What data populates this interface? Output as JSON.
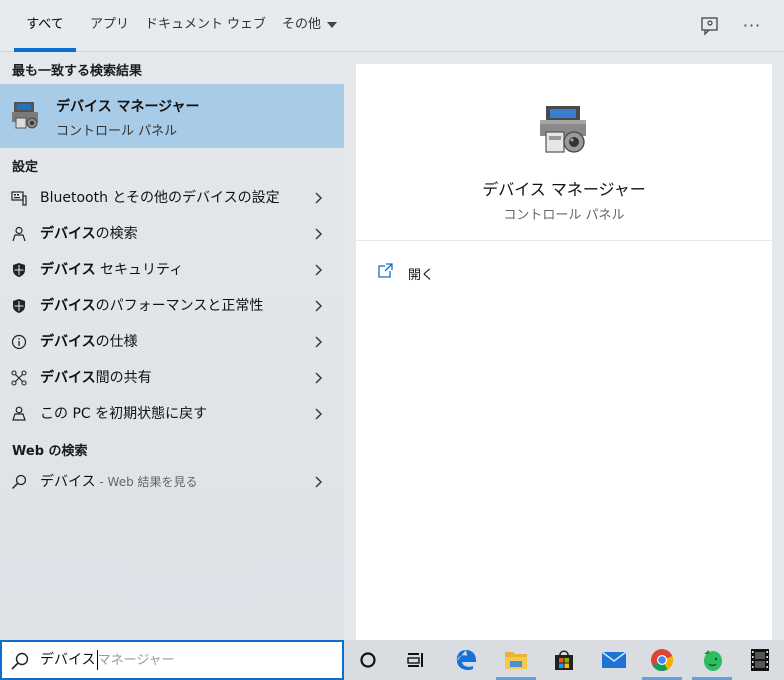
{
  "tabs": [
    {
      "label": "すべて",
      "active": true
    },
    {
      "label": "アプリ"
    },
    {
      "label": "ドキュメント"
    },
    {
      "label": "ウェブ"
    },
    {
      "label": "その他"
    }
  ],
  "top_icons": [
    "feedback-icon",
    "more-options-icon"
  ],
  "left": {
    "best_match_header": "最も一致する検索結果",
    "best_match": {
      "title": "デバイス マネージャー",
      "subtitle": "コントロール パネル",
      "icon": "device-manager-icon"
    },
    "settings_header": "設定",
    "settings_items": [
      {
        "pre": "",
        "bold": "",
        "post": "Bluetooth とその他のデバイスの設定",
        "icon": "keyboard-device-icon"
      },
      {
        "pre": "",
        "bold": "デバイス",
        "post": "の検索",
        "icon": "person-search-icon"
      },
      {
        "pre": "",
        "bold": "デバイス",
        "post": " セキュリティ",
        "icon": "shield-icon"
      },
      {
        "pre": "",
        "bold": "デバイス",
        "post": "のパフォーマンスと正常性",
        "icon": "shield-icon"
      },
      {
        "pre": "",
        "bold": "デバイス",
        "post": "の仕様",
        "icon": "info-icon"
      },
      {
        "pre": "",
        "bold": "デバイス",
        "post": "間の共有",
        "icon": "share-icon"
      },
      {
        "pre": "この PC を初期状態に戻す",
        "bold": "",
        "post": "",
        "icon": "reset-pc-icon"
      }
    ],
    "web_header": "Web の検索",
    "web_item": {
      "query": "デバイス",
      "suffix": " - Web 結果を見る",
      "icon": "search-icon"
    }
  },
  "preview": {
    "title": "デバイス マネージャー",
    "subtitle": "コントロール パネル",
    "open_label": "開く"
  },
  "search": {
    "typed": "デバイス",
    "suggestion": "マネージャー"
  },
  "taskbar": {
    "items": [
      {
        "name": "cortana-icon",
        "running": false
      },
      {
        "name": "task-view-icon",
        "running": false
      },
      {
        "name": "edge-icon",
        "running": false
      },
      {
        "name": "file-explorer-icon",
        "running": true
      },
      {
        "name": "store-icon",
        "running": false
      },
      {
        "name": "mail-icon",
        "running": false
      },
      {
        "name": "chrome-icon",
        "running": true
      },
      {
        "name": "evernote-icon",
        "running": true
      },
      {
        "name": "film-icon",
        "running": false
      }
    ]
  },
  "colors": {
    "accent": "#0a6ed1",
    "selected_row": "#a8cce8"
  }
}
